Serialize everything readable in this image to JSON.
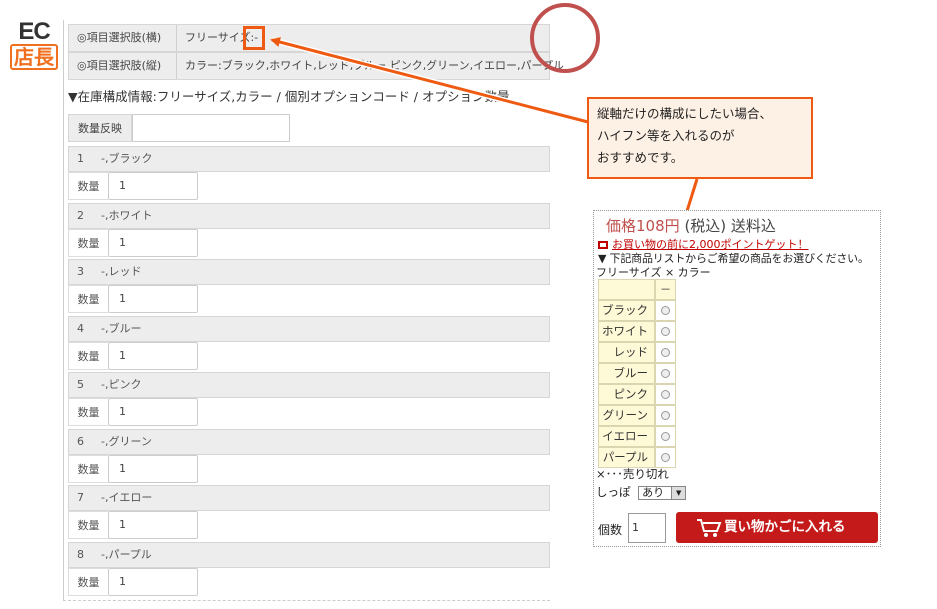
{
  "logo": {
    "line1": "EC",
    "line2": "店長"
  },
  "option_headers": [
    {
      "label": "◎項目選択肢(横)",
      "value": "フリーサイズ:-"
    },
    {
      "label": "◎項目選択肢(縦)",
      "value": "カラー:ブラック,ホワイト,レッド,ブルー,ピンク,グリーン,イエロー,パープル"
    }
  ],
  "stock_title": "▼在庫構成情報:フリーサイズ,カラー / 個別オプションコード / オプション数量",
  "qty_reflect_label": "数量反映",
  "qty_label": "数量",
  "items": [
    {
      "num": "1",
      "name": "-,ブラック",
      "qty": "1"
    },
    {
      "num": "2",
      "name": "-,ホワイト",
      "qty": "1"
    },
    {
      "num": "3",
      "name": "-,レッド",
      "qty": "1"
    },
    {
      "num": "4",
      "name": "-,ブルー",
      "qty": "1"
    },
    {
      "num": "5",
      "name": "-,ピンク",
      "qty": "1"
    },
    {
      "num": "6",
      "name": "-,グリーン",
      "qty": "1"
    },
    {
      "num": "7",
      "name": "-,イエロー",
      "qty": "1"
    },
    {
      "num": "8",
      "name": "-,パープル",
      "qty": "1"
    }
  ],
  "callout": {
    "line1": "縦軸だけの構成にしたい場合、",
    "line2": "ハイフン等を入れるのが",
    "line3": "おすすめです。"
  },
  "product": {
    "price_prefix": "価格",
    "price": "108円",
    "price_suffix": "(税込) 送料込",
    "point_text": "お買い物の前に2,000ポイントゲット！",
    "select_text": "▼ 下記商品リストからご希望の商品をお選びください。",
    "axis_text": "フリーサイズ × カラー",
    "column_header": "－",
    "colors": [
      "ブラック",
      "ホワイト",
      "レッド",
      "ブルー",
      "ピンク",
      "グリーン",
      "イエロー",
      "パープル"
    ],
    "soldout_text": "×･･･売り切れ",
    "tail_label": "しっぽ",
    "tail_value": "あり",
    "qty_label": "個数",
    "qty_value": "1",
    "cart_label": "買い物かごに入れる"
  },
  "colors": {
    "accent": "#ee5a12",
    "circle": "#c0504d",
    "cart": "#c41a1a",
    "price": "#c0504d"
  }
}
